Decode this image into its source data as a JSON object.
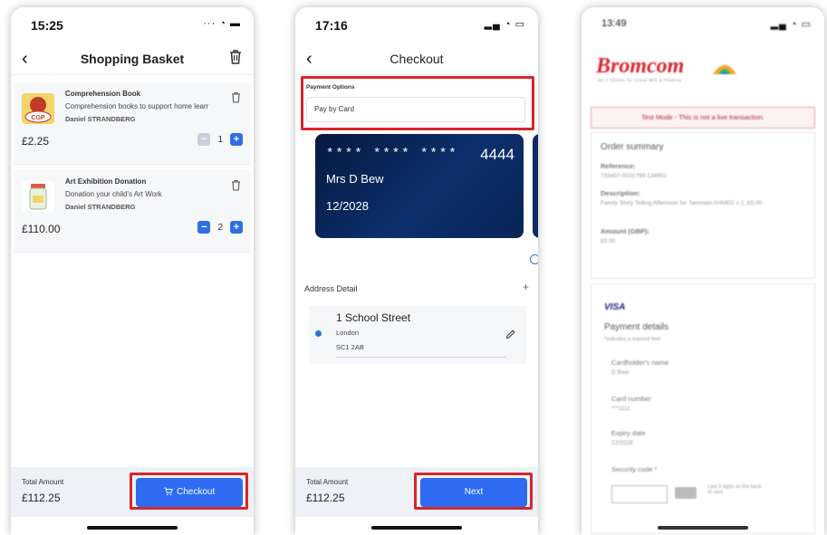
{
  "basket": {
    "time": "15:25",
    "title": "Shopping Basket",
    "items": [
      {
        "name": "Comprehension Book",
        "description": "Comprehension books to support home learr",
        "pupil": "Daniel STRANDBERG",
        "thumb_text": "CGP",
        "price": "£2.25",
        "qty": "1"
      },
      {
        "name": "Art Exhibition Donation",
        "description": "Donation your child's Art Work",
        "pupil": "Daniel STRANDBERG",
        "price": "£110.00",
        "qty": "2"
      }
    ],
    "total_label": "Total Amount",
    "total_value": "£112.25",
    "checkout_label": "Checkout"
  },
  "checkout": {
    "time": "17:16",
    "title": "Checkout",
    "payment_options_label": "Payment Options",
    "payment_method": "Pay by Card",
    "card": {
      "masked": "****  ****  ****",
      "last4": "4444",
      "holder": "Mrs D Bew",
      "expiry": "12/2028"
    },
    "address_header": "Address Detail",
    "address": {
      "street": "1 School Street",
      "town": "London",
      "postcode": "SC1 2AB"
    },
    "total_label": "Total Amount",
    "total_value": "£112.25",
    "next_label": "Next"
  },
  "bromcom": {
    "time": "13:49",
    "logo": "Bromcom",
    "logo_tagline": "No.1 Choice for Cloud MIS & Finance",
    "test_mode": "Test Mode - This is not a live transaction.",
    "order_summary": "Order summary",
    "reference_label": "Reference:",
    "reference": "733407-0031799-134902",
    "description_label": "Description:",
    "description": "Family Story Telling Afternoon for Tammasi AHMED x 1, £5.00",
    "amount_label": "Amount (GBP):",
    "amount": "£5.00",
    "card_brand": "VISA",
    "payment_details": "Payment details",
    "required_note": "*Indicates a required field",
    "cardholder_label": "Cardholder's name",
    "cardholder": "D Bew",
    "card_number_label": "Card number",
    "card_number": "***1111",
    "expiry_label": "Expiry date",
    "expiry": "12/2028",
    "security_label": "Security code *",
    "security_hint": "Last 3 digits on the back of card"
  },
  "colors": {
    "accent": "#2e6bf0",
    "highlight": "#d8262c",
    "brand_red": "#d8262c"
  }
}
